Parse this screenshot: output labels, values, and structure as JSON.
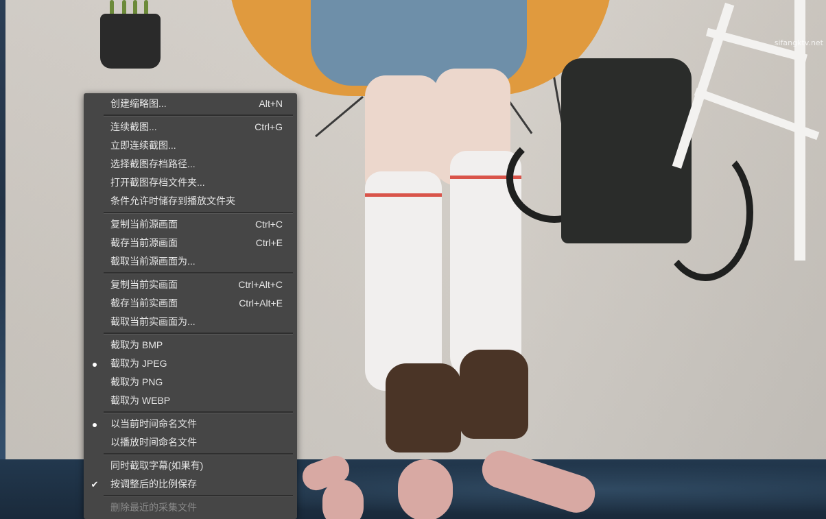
{
  "watermark": "sifangktv.net",
  "menu": {
    "items": [
      {
        "label": "创建缩略图...",
        "shortcut": "Alt+N",
        "mark": ""
      },
      {
        "label": "连续截图...",
        "shortcut": "Ctrl+G",
        "mark": ""
      },
      {
        "label": "立即连续截图...",
        "shortcut": "",
        "mark": ""
      },
      {
        "label": "选择截图存档路径...",
        "shortcut": "",
        "mark": ""
      },
      {
        "label": "打开截图存档文件夹...",
        "shortcut": "",
        "mark": ""
      },
      {
        "label": "条件允许时储存到播放文件夹",
        "shortcut": "",
        "mark": ""
      },
      {
        "label": "复制当前源画面",
        "shortcut": "Ctrl+C",
        "mark": ""
      },
      {
        "label": "截存当前源画面",
        "shortcut": "Ctrl+E",
        "mark": ""
      },
      {
        "label": "截取当前源画面为...",
        "shortcut": "",
        "mark": ""
      },
      {
        "label": "复制当前实画面",
        "shortcut": "Ctrl+Alt+C",
        "mark": ""
      },
      {
        "label": "截存当前实画面",
        "shortcut": "Ctrl+Alt+E",
        "mark": ""
      },
      {
        "label": "截取当前实画面为...",
        "shortcut": "",
        "mark": ""
      },
      {
        "label": "截取为 BMP",
        "shortcut": "",
        "mark": ""
      },
      {
        "label": "截取为 JPEG",
        "shortcut": "",
        "mark": "radio"
      },
      {
        "label": "截取为 PNG",
        "shortcut": "",
        "mark": ""
      },
      {
        "label": "截取为 WEBP",
        "shortcut": "",
        "mark": ""
      },
      {
        "label": "以当前时间命名文件",
        "shortcut": "",
        "mark": "radio"
      },
      {
        "label": "以播放时间命名文件",
        "shortcut": "",
        "mark": ""
      },
      {
        "label": "同时截取字幕(如果有)",
        "shortcut": "",
        "mark": ""
      },
      {
        "label": "按调整后的比例保存",
        "shortcut": "",
        "mark": "check"
      },
      {
        "label": "删除最近的采集文件",
        "shortcut": "",
        "mark": "",
        "disabled": true
      }
    ],
    "check_glyph": "✔"
  }
}
